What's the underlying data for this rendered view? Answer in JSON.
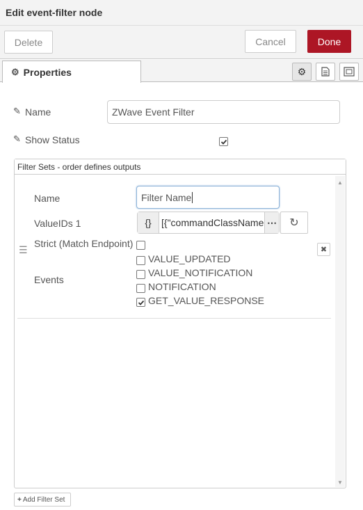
{
  "header": {
    "title": "Edit event-filter node"
  },
  "toolbar": {
    "delete_label": "Delete",
    "cancel_label": "Cancel",
    "done_label": "Done"
  },
  "tabs": {
    "properties_label": "Properties"
  },
  "form": {
    "name_label": "Name",
    "name_value": "ZWave Event Filter",
    "show_status_label": "Show Status",
    "show_status_checked": true
  },
  "filter_sets": {
    "header": "Filter Sets - order defines outputs",
    "name_label": "Name",
    "name_value": "Filter Name",
    "valueids_label": "ValueIDs 1",
    "valueids_type": "{}",
    "valueids_value": "[{\"commandClassName\"",
    "strict_label": "Strict (Match Endpoint)",
    "events_label": "Events",
    "events": [
      {
        "label": "VALUE_UPDATED",
        "checked": false
      },
      {
        "label": "VALUE_NOTIFICATION",
        "checked": false
      },
      {
        "label": "NOTIFICATION",
        "checked": false
      },
      {
        "label": "GET_VALUE_RESPONSE",
        "checked": true
      }
    ],
    "add_button": "Add Filter Set"
  },
  "colors": {
    "primary": "#ad1625",
    "border": "#cccccc",
    "focus": "#8fb4d9"
  }
}
